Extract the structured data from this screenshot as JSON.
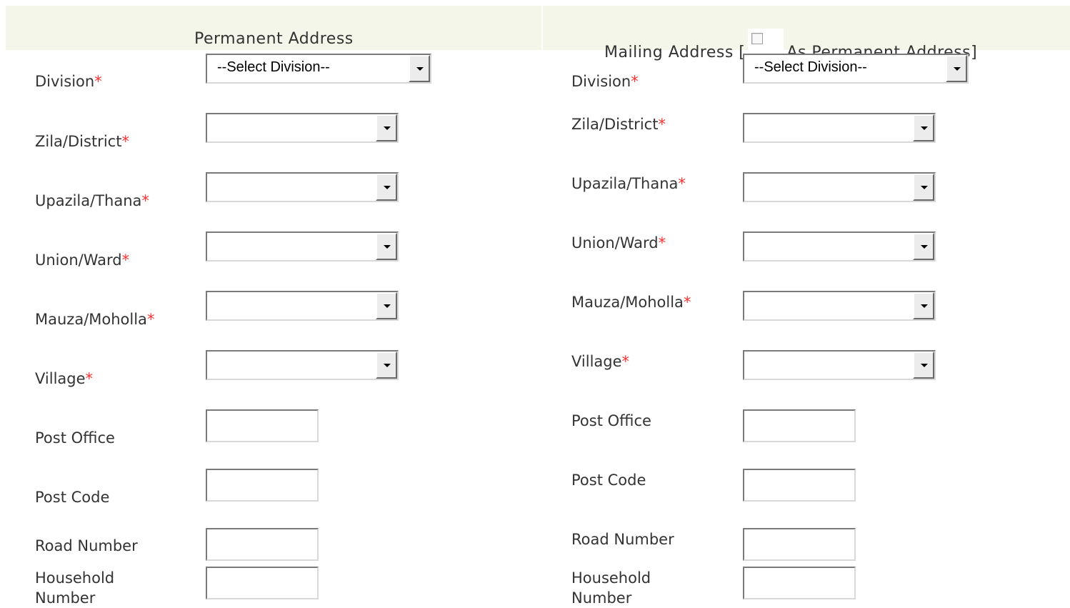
{
  "permanent": {
    "header": "Permanent Address",
    "division_label": "Division",
    "division_value": "--Select Division--",
    "zila_label": "Zila/District",
    "upazila_label": "Upazila/Thana",
    "union_label": "Union/Ward",
    "mauza_label": "Mauza/Moholla",
    "village_label": "Village",
    "post_office_label": "Post Office",
    "post_code_label": "Post Code",
    "road_label": "Road Number",
    "household_label": "Household Number"
  },
  "mailing": {
    "header_prefix": "Mailing Address [",
    "header_suffix": "As Permanent Address]",
    "same_as_permanent_checked": false,
    "division_label": "Division",
    "division_value": "--Select Division--",
    "zila_label": "Zila/District",
    "upazila_label": "Upazila/Thana",
    "union_label": "Union/Ward",
    "mauza_label": "Mauza/Moholla",
    "village_label": "Village",
    "post_office_label": "Post Office",
    "post_code_label": "Post Code",
    "road_label": "Road Number",
    "household_label": "Household Number"
  },
  "required_marker": "*",
  "colors": {
    "header_bg": "#f3f6e9",
    "required": "#ff3030",
    "label_text": "#333333"
  }
}
